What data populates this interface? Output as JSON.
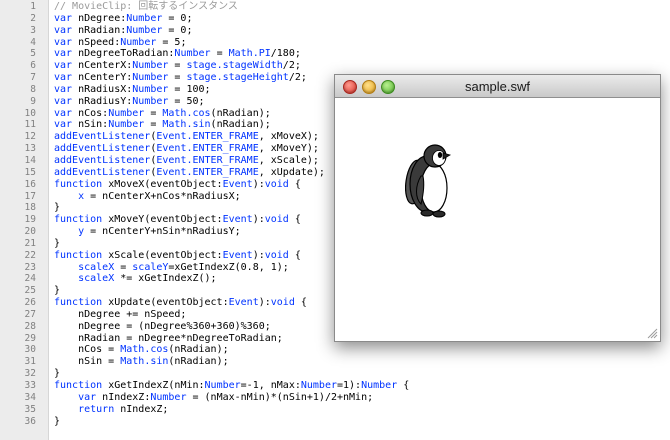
{
  "editor": {
    "lines": [
      {
        "n": "1",
        "t": [
          [
            "cm",
            "// MovieClip: 回転するインスタンス"
          ]
        ]
      },
      {
        "n": "2",
        "t": [
          [
            "kw",
            "var"
          ],
          [
            "p",
            " nDegree:"
          ],
          [
            "kw",
            "Number"
          ],
          [
            "p",
            " = 0;"
          ]
        ]
      },
      {
        "n": "3",
        "t": [
          [
            "kw",
            "var"
          ],
          [
            "p",
            " nRadian:"
          ],
          [
            "kw",
            "Number"
          ],
          [
            "p",
            " = 0;"
          ]
        ]
      },
      {
        "n": "4",
        "t": [
          [
            "kw",
            "var"
          ],
          [
            "p",
            " nSpeed:"
          ],
          [
            "kw",
            "Number"
          ],
          [
            "p",
            " = 5;"
          ]
        ]
      },
      {
        "n": "5",
        "t": [
          [
            "kw",
            "var"
          ],
          [
            "p",
            " nDegreeToRadian:"
          ],
          [
            "kw",
            "Number"
          ],
          [
            "p",
            " = "
          ],
          [
            "kw",
            "Math.PI"
          ],
          [
            "p",
            "/180;"
          ]
        ]
      },
      {
        "n": "6",
        "t": [
          [
            "kw",
            "var"
          ],
          [
            "p",
            " nCenterX:"
          ],
          [
            "kw",
            "Number"
          ],
          [
            "p",
            " = "
          ],
          [
            "kw",
            "stage.stageWidth"
          ],
          [
            "p",
            "/2;"
          ]
        ]
      },
      {
        "n": "7",
        "t": [
          [
            "kw",
            "var"
          ],
          [
            "p",
            " nCenterY:"
          ],
          [
            "kw",
            "Number"
          ],
          [
            "p",
            " = "
          ],
          [
            "kw",
            "stage.stageHeight"
          ],
          [
            "p",
            "/2;"
          ]
        ]
      },
      {
        "n": "8",
        "t": [
          [
            "kw",
            "var"
          ],
          [
            "p",
            " nRadiusX:"
          ],
          [
            "kw",
            "Number"
          ],
          [
            "p",
            " = 100;"
          ]
        ]
      },
      {
        "n": "9",
        "t": [
          [
            "kw",
            "var"
          ],
          [
            "p",
            " nRadiusY:"
          ],
          [
            "kw",
            "Number"
          ],
          [
            "p",
            " = 50;"
          ]
        ]
      },
      {
        "n": "10",
        "t": [
          [
            "kw",
            "var"
          ],
          [
            "p",
            " nCos:"
          ],
          [
            "kw",
            "Number"
          ],
          [
            "p",
            " = "
          ],
          [
            "kw",
            "Math.cos"
          ],
          [
            "p",
            "(nRadian);"
          ]
        ]
      },
      {
        "n": "11",
        "t": [
          [
            "kw",
            "var"
          ],
          [
            "p",
            " nSin:"
          ],
          [
            "kw",
            "Number"
          ],
          [
            "p",
            " = "
          ],
          [
            "kw",
            "Math.sin"
          ],
          [
            "p",
            "(nRadian);"
          ]
        ]
      },
      {
        "n": "12",
        "t": [
          [
            "kw",
            "addEventListener"
          ],
          [
            "p",
            "("
          ],
          [
            "kw",
            "Event.ENTER_FRAME"
          ],
          [
            "p",
            ", xMoveX);"
          ]
        ]
      },
      {
        "n": "13",
        "t": [
          [
            "kw",
            "addEventListener"
          ],
          [
            "p",
            "("
          ],
          [
            "kw",
            "Event.ENTER_FRAME"
          ],
          [
            "p",
            ", xMoveY);"
          ]
        ]
      },
      {
        "n": "14",
        "t": [
          [
            "kw",
            "addEventListener"
          ],
          [
            "p",
            "("
          ],
          [
            "kw",
            "Event.ENTER_FRAME"
          ],
          [
            "p",
            ", xScale);"
          ]
        ]
      },
      {
        "n": "15",
        "t": [
          [
            "kw",
            "addEventListener"
          ],
          [
            "p",
            "("
          ],
          [
            "kw",
            "Event.ENTER_FRAME"
          ],
          [
            "p",
            ", xUpdate);"
          ]
        ]
      },
      {
        "n": "16",
        "t": [
          [
            "kw",
            "function"
          ],
          [
            "p",
            " xMoveX(eventObject:"
          ],
          [
            "kw",
            "Event"
          ],
          [
            "p",
            "):"
          ],
          [
            "kw",
            "void"
          ],
          [
            "p",
            " {"
          ]
        ]
      },
      {
        "n": "17",
        "t": [
          [
            "p",
            "    "
          ],
          [
            "kw",
            "x"
          ],
          [
            "p",
            " = nCenterX+nCos*nRadiusX;"
          ]
        ]
      },
      {
        "n": "18",
        "t": [
          [
            "p",
            "}"
          ]
        ]
      },
      {
        "n": "19",
        "t": [
          [
            "kw",
            "function"
          ],
          [
            "p",
            " xMoveY(eventObject:"
          ],
          [
            "kw",
            "Event"
          ],
          [
            "p",
            "):"
          ],
          [
            "kw",
            "void"
          ],
          [
            "p",
            " {"
          ]
        ]
      },
      {
        "n": "20",
        "t": [
          [
            "p",
            "    "
          ],
          [
            "kw",
            "y"
          ],
          [
            "p",
            " = nCenterY+nSin*nRadiusY;"
          ]
        ]
      },
      {
        "n": "21",
        "t": [
          [
            "p",
            "}"
          ]
        ]
      },
      {
        "n": "22",
        "t": [
          [
            "kw",
            "function"
          ],
          [
            "p",
            " xScale(eventObject:"
          ],
          [
            "kw",
            "Event"
          ],
          [
            "p",
            "):"
          ],
          [
            "kw",
            "void"
          ],
          [
            "p",
            " {"
          ]
        ]
      },
      {
        "n": "23",
        "t": [
          [
            "p",
            "    "
          ],
          [
            "kw",
            "scaleX"
          ],
          [
            "p",
            " = "
          ],
          [
            "kw",
            "scaleY"
          ],
          [
            "p",
            "=xGetIndexZ(0.8, 1);"
          ]
        ]
      },
      {
        "n": "24",
        "t": [
          [
            "p",
            "    "
          ],
          [
            "kw",
            "scaleX"
          ],
          [
            "p",
            " *= xGetIndexZ();"
          ]
        ]
      },
      {
        "n": "25",
        "t": [
          [
            "p",
            "}"
          ]
        ]
      },
      {
        "n": "26",
        "t": [
          [
            "kw",
            "function"
          ],
          [
            "p",
            " xUpdate(eventObject:"
          ],
          [
            "kw",
            "Event"
          ],
          [
            "p",
            "):"
          ],
          [
            "kw",
            "void"
          ],
          [
            "p",
            " {"
          ]
        ]
      },
      {
        "n": "27",
        "t": [
          [
            "p",
            "    nDegree += nSpeed;"
          ]
        ]
      },
      {
        "n": "28",
        "t": [
          [
            "p",
            "    nDegree = (nDegree%360+360)%360;"
          ]
        ]
      },
      {
        "n": "29",
        "t": [
          [
            "p",
            "    nRadian = nDegree*nDegreeToRadian;"
          ]
        ]
      },
      {
        "n": "30",
        "t": [
          [
            "p",
            "    nCos = "
          ],
          [
            "kw",
            "Math.cos"
          ],
          [
            "p",
            "(nRadian);"
          ]
        ]
      },
      {
        "n": "31",
        "t": [
          [
            "p",
            "    nSin = "
          ],
          [
            "kw",
            "Math.sin"
          ],
          [
            "p",
            "(nRadian);"
          ]
        ]
      },
      {
        "n": "32",
        "t": [
          [
            "p",
            "}"
          ]
        ]
      },
      {
        "n": "33",
        "t": [
          [
            "kw",
            "function"
          ],
          [
            "p",
            " xGetIndexZ(nMin:"
          ],
          [
            "kw",
            "Number"
          ],
          [
            "p",
            "=-1, nMax:"
          ],
          [
            "kw",
            "Number"
          ],
          [
            "p",
            "=1):"
          ],
          [
            "kw",
            "Number"
          ],
          [
            "p",
            " {"
          ]
        ]
      },
      {
        "n": "34",
        "t": [
          [
            "p",
            "    "
          ],
          [
            "kw",
            "var"
          ],
          [
            "p",
            " nIndexZ:"
          ],
          [
            "kw",
            "Number"
          ],
          [
            "p",
            " = (nMax-nMin)*(nSin+1)/2+nMin;"
          ]
        ]
      },
      {
        "n": "35",
        "t": [
          [
            "p",
            "    "
          ],
          [
            "kw",
            "return"
          ],
          [
            "p",
            " nIndexZ;"
          ]
        ]
      },
      {
        "n": "36",
        "t": [
          [
            "p",
            "}"
          ]
        ]
      }
    ]
  },
  "swf_window": {
    "title": "sample.swf"
  },
  "colors": {
    "keyword": "#0033ff",
    "comment": "#9a9a9a",
    "gutter": "#ececec"
  },
  "icons": {
    "close": "close-button-icon",
    "minimize": "minimize-button-icon",
    "zoom": "zoom-button-icon",
    "resize": "resize-grip-icon",
    "stage_image": "penguin-icon"
  }
}
